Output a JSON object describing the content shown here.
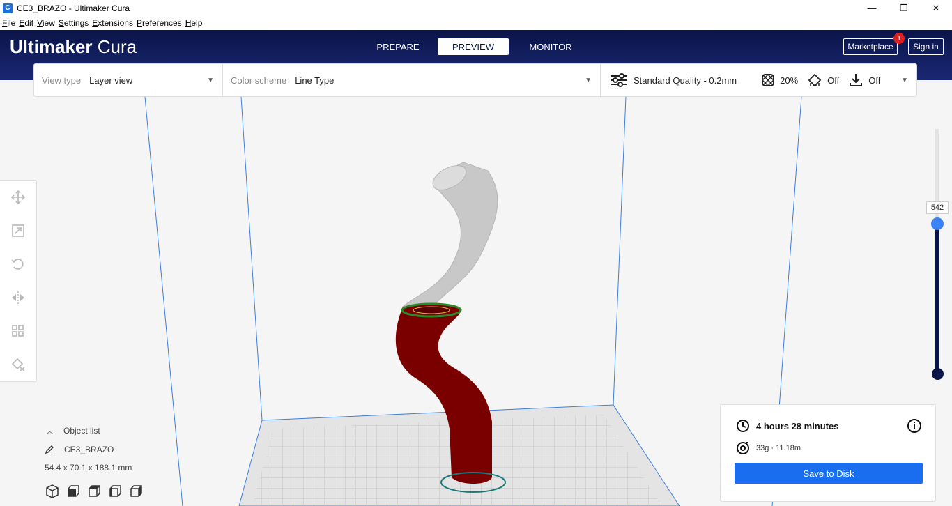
{
  "window": {
    "title": "CE3_BRAZO - Ultimaker Cura",
    "app_icon_letter": "C",
    "minimize": "—",
    "restore": "❐",
    "close": "✕"
  },
  "menu": [
    "File",
    "Edit",
    "View",
    "Settings",
    "Extensions",
    "Preferences",
    "Help"
  ],
  "header": {
    "logo_bold": "Ultimaker",
    "logo_light": "Cura",
    "stages": [
      "PREPARE",
      "PREVIEW",
      "MONITOR"
    ],
    "active_stage": "PREVIEW",
    "marketplace_label": "Marketplace",
    "marketplace_badge": "1",
    "signin_label": "Sign in"
  },
  "toolbar": {
    "view_type_label": "View type",
    "view_type_value": "Layer view",
    "color_scheme_label": "Color scheme",
    "color_scheme_value": "Line Type",
    "quality": "Standard Quality - 0.2mm",
    "infill": "20%",
    "support": "Off",
    "adhesion": "Off"
  },
  "layer_slider": {
    "value": "542"
  },
  "object_list": {
    "title": "Object list",
    "object_name": "CE3_BRAZO",
    "dimensions": "54.4 x 70.1 x 188.1 mm"
  },
  "print_info": {
    "time": "4 hours 28 minutes",
    "material": "33g · 11.18m",
    "save_label": "Save to Disk"
  },
  "colors": {
    "header": "#0b1447",
    "accent": "#196ef0",
    "model_printed": "#7a0000",
    "model_unprinted": "#c8c8c8"
  }
}
